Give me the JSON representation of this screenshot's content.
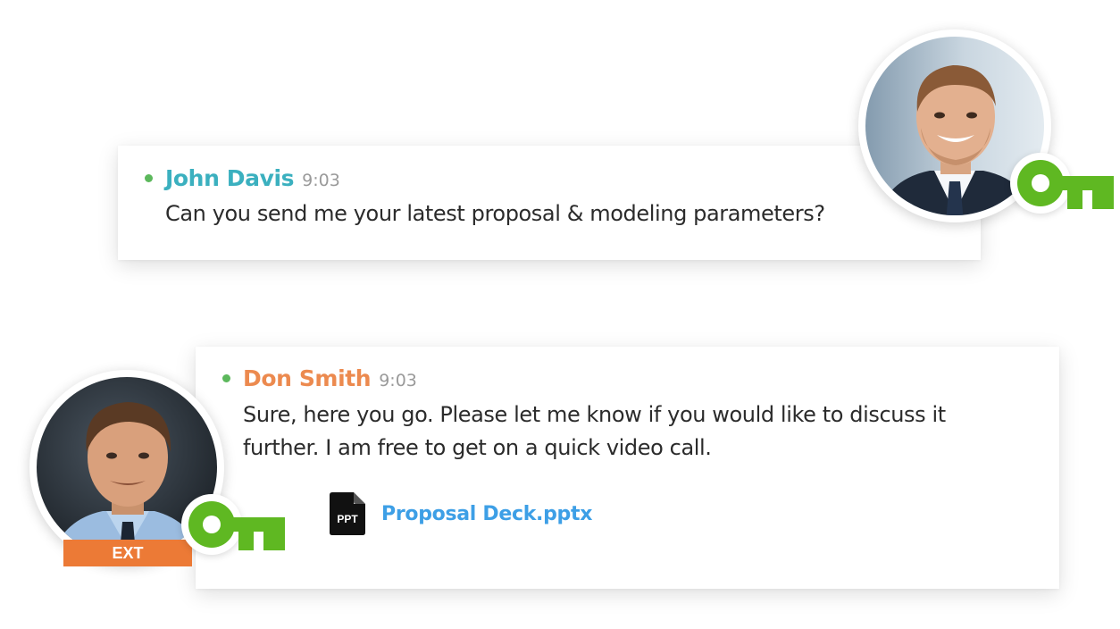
{
  "messages": [
    {
      "sender": "John Davis",
      "time": "9:03",
      "text": "Can you send me your latest proposal & modeling parameters?",
      "presence_color": "#5cb85c",
      "name_color": "#3bb0bf",
      "key_icon": "key-icon"
    },
    {
      "sender": "Don Smith",
      "time": "9:03",
      "text": "Sure, here you go. Please let me know if you would like to discuss it further. I am free to get on a quick video call.",
      "presence_color": "#5cb85c",
      "name_color": "#ec8a4f",
      "badge": "EXT",
      "key_icon": "key-icon",
      "attachment": {
        "icon_label": "PPT",
        "icon": "ppt-file-icon",
        "filename": "Proposal Deck.pptx"
      }
    }
  ],
  "colors": {
    "key_green": "#5fb822",
    "external_badge": "#ec7a36",
    "link_blue": "#3d9fe6"
  }
}
